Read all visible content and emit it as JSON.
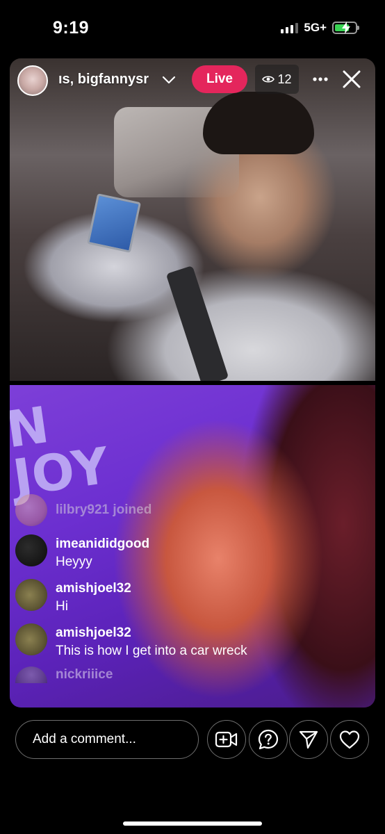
{
  "status": {
    "time": "9:19",
    "network": "5G+"
  },
  "header": {
    "host_names": "ıs, bigfannysr",
    "live_label": "Live",
    "viewer_count": "12"
  },
  "comments": {
    "join": {
      "username": "lilbry921",
      "text": "lilbry921 joined"
    },
    "items": [
      {
        "username": "imeanididgood",
        "message": "Heyyy"
      },
      {
        "username": "amishjoel32",
        "message": "Hi"
      },
      {
        "username": "amishjoel32",
        "message": "This is how I get into a car wreck"
      }
    ],
    "partial": {
      "username": "nickriiice"
    }
  },
  "composer": {
    "placeholder": "Add a comment..."
  },
  "icons": {
    "more": "more-icon",
    "close": "close-icon",
    "add_guest": "add-video-icon",
    "question": "question-icon",
    "share": "send-icon",
    "like": "heart-icon"
  },
  "colors": {
    "live_badge": "#e4265c",
    "background": "#000000"
  }
}
